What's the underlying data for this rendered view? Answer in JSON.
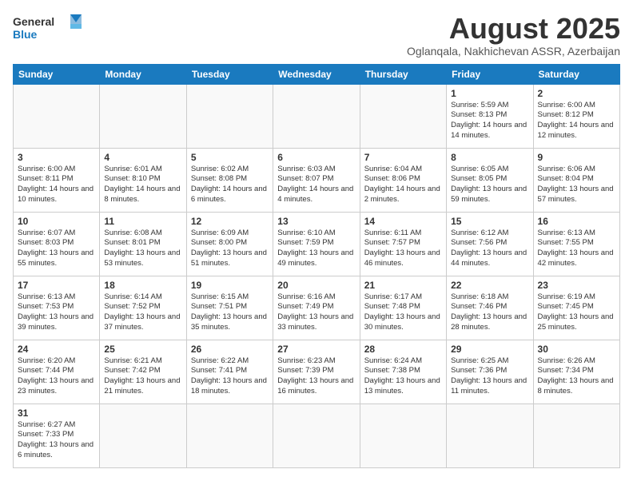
{
  "header": {
    "logo_general": "General",
    "logo_blue": "Blue",
    "month_title": "August 2025",
    "location": "Oglanqala, Nakhichevan ASSR, Azerbaijan"
  },
  "days_of_week": [
    "Sunday",
    "Monday",
    "Tuesday",
    "Wednesday",
    "Thursday",
    "Friday",
    "Saturday"
  ],
  "weeks": [
    [
      {
        "day": "",
        "info": ""
      },
      {
        "day": "",
        "info": ""
      },
      {
        "day": "",
        "info": ""
      },
      {
        "day": "",
        "info": ""
      },
      {
        "day": "",
        "info": ""
      },
      {
        "day": "1",
        "info": "Sunrise: 5:59 AM\nSunset: 8:13 PM\nDaylight: 14 hours and 14 minutes."
      },
      {
        "day": "2",
        "info": "Sunrise: 6:00 AM\nSunset: 8:12 PM\nDaylight: 14 hours and 12 minutes."
      }
    ],
    [
      {
        "day": "3",
        "info": "Sunrise: 6:00 AM\nSunset: 8:11 PM\nDaylight: 14 hours and 10 minutes."
      },
      {
        "day": "4",
        "info": "Sunrise: 6:01 AM\nSunset: 8:10 PM\nDaylight: 14 hours and 8 minutes."
      },
      {
        "day": "5",
        "info": "Sunrise: 6:02 AM\nSunset: 8:08 PM\nDaylight: 14 hours and 6 minutes."
      },
      {
        "day": "6",
        "info": "Sunrise: 6:03 AM\nSunset: 8:07 PM\nDaylight: 14 hours and 4 minutes."
      },
      {
        "day": "7",
        "info": "Sunrise: 6:04 AM\nSunset: 8:06 PM\nDaylight: 14 hours and 2 minutes."
      },
      {
        "day": "8",
        "info": "Sunrise: 6:05 AM\nSunset: 8:05 PM\nDaylight: 13 hours and 59 minutes."
      },
      {
        "day": "9",
        "info": "Sunrise: 6:06 AM\nSunset: 8:04 PM\nDaylight: 13 hours and 57 minutes."
      }
    ],
    [
      {
        "day": "10",
        "info": "Sunrise: 6:07 AM\nSunset: 8:03 PM\nDaylight: 13 hours and 55 minutes."
      },
      {
        "day": "11",
        "info": "Sunrise: 6:08 AM\nSunset: 8:01 PM\nDaylight: 13 hours and 53 minutes."
      },
      {
        "day": "12",
        "info": "Sunrise: 6:09 AM\nSunset: 8:00 PM\nDaylight: 13 hours and 51 minutes."
      },
      {
        "day": "13",
        "info": "Sunrise: 6:10 AM\nSunset: 7:59 PM\nDaylight: 13 hours and 49 minutes."
      },
      {
        "day": "14",
        "info": "Sunrise: 6:11 AM\nSunset: 7:57 PM\nDaylight: 13 hours and 46 minutes."
      },
      {
        "day": "15",
        "info": "Sunrise: 6:12 AM\nSunset: 7:56 PM\nDaylight: 13 hours and 44 minutes."
      },
      {
        "day": "16",
        "info": "Sunrise: 6:13 AM\nSunset: 7:55 PM\nDaylight: 13 hours and 42 minutes."
      }
    ],
    [
      {
        "day": "17",
        "info": "Sunrise: 6:13 AM\nSunset: 7:53 PM\nDaylight: 13 hours and 39 minutes."
      },
      {
        "day": "18",
        "info": "Sunrise: 6:14 AM\nSunset: 7:52 PM\nDaylight: 13 hours and 37 minutes."
      },
      {
        "day": "19",
        "info": "Sunrise: 6:15 AM\nSunset: 7:51 PM\nDaylight: 13 hours and 35 minutes."
      },
      {
        "day": "20",
        "info": "Sunrise: 6:16 AM\nSunset: 7:49 PM\nDaylight: 13 hours and 33 minutes."
      },
      {
        "day": "21",
        "info": "Sunrise: 6:17 AM\nSunset: 7:48 PM\nDaylight: 13 hours and 30 minutes."
      },
      {
        "day": "22",
        "info": "Sunrise: 6:18 AM\nSunset: 7:46 PM\nDaylight: 13 hours and 28 minutes."
      },
      {
        "day": "23",
        "info": "Sunrise: 6:19 AM\nSunset: 7:45 PM\nDaylight: 13 hours and 25 minutes."
      }
    ],
    [
      {
        "day": "24",
        "info": "Sunrise: 6:20 AM\nSunset: 7:44 PM\nDaylight: 13 hours and 23 minutes."
      },
      {
        "day": "25",
        "info": "Sunrise: 6:21 AM\nSunset: 7:42 PM\nDaylight: 13 hours and 21 minutes."
      },
      {
        "day": "26",
        "info": "Sunrise: 6:22 AM\nSunset: 7:41 PM\nDaylight: 13 hours and 18 minutes."
      },
      {
        "day": "27",
        "info": "Sunrise: 6:23 AM\nSunset: 7:39 PM\nDaylight: 13 hours and 16 minutes."
      },
      {
        "day": "28",
        "info": "Sunrise: 6:24 AM\nSunset: 7:38 PM\nDaylight: 13 hours and 13 minutes."
      },
      {
        "day": "29",
        "info": "Sunrise: 6:25 AM\nSunset: 7:36 PM\nDaylight: 13 hours and 11 minutes."
      },
      {
        "day": "30",
        "info": "Sunrise: 6:26 AM\nSunset: 7:34 PM\nDaylight: 13 hours and 8 minutes."
      }
    ],
    [
      {
        "day": "31",
        "info": "Sunrise: 6:27 AM\nSunset: 7:33 PM\nDaylight: 13 hours and 6 minutes."
      },
      {
        "day": "",
        "info": ""
      },
      {
        "day": "",
        "info": ""
      },
      {
        "day": "",
        "info": ""
      },
      {
        "day": "",
        "info": ""
      },
      {
        "day": "",
        "info": ""
      },
      {
        "day": "",
        "info": ""
      }
    ]
  ]
}
